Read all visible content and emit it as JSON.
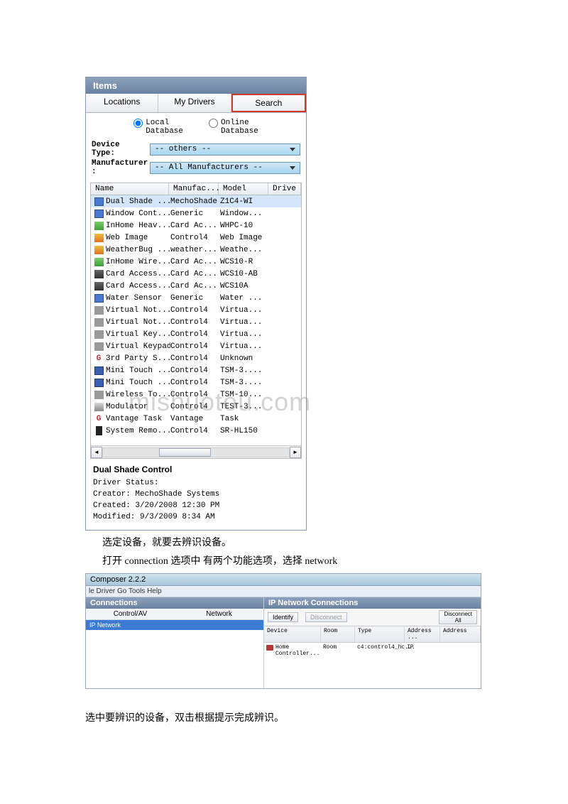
{
  "items_panel": {
    "title": "Items",
    "tabs": [
      "Locations",
      "My Drivers",
      "Search"
    ],
    "radios": {
      "local": "Local\nDatabase",
      "online": "Online\nDatabase"
    },
    "filters": {
      "device_type_label": "Device\nType:",
      "device_type_value": "-- others --",
      "manufacturer_label": "Manufacturer\n:",
      "manufacturer_value": "-- All Manufacturers --"
    },
    "columns": {
      "name": "Name",
      "manufacturer": "Manufac...",
      "model": "Model",
      "driver": "Drive"
    },
    "rows": [
      {
        "icon": "ico-blue",
        "name": "Dual Shade ...",
        "manufacturer": "MechoShade",
        "model": "Z1C4-WI",
        "selected": true
      },
      {
        "icon": "ico-blue",
        "name": "Window Cont...",
        "manufacturer": "Generic",
        "model": "Window..."
      },
      {
        "icon": "ico-grn",
        "name": "InHome Heav...",
        "manufacturer": "Card Ac...",
        "model": "WHPC-10"
      },
      {
        "icon": "ico-wb",
        "name": "Web Image",
        "manufacturer": "Control4",
        "model": "Web Image"
      },
      {
        "icon": "ico-wb",
        "name": "WeatherBug ...",
        "manufacturer": "weather...",
        "model": "Weathe..."
      },
      {
        "icon": "ico-grn",
        "name": "InHome Wire...",
        "manufacturer": "Card Ac...",
        "model": "WCS10-R"
      },
      {
        "icon": "ico-dk",
        "name": "Card Access...",
        "manufacturer": "Card Ac...",
        "model": "WCS10-AB"
      },
      {
        "icon": "ico-dk",
        "name": "Card Access...",
        "manufacturer": "Card Ac...",
        "model": "WCS10A"
      },
      {
        "icon": "ico-blue",
        "name": "Water Sensor",
        "manufacturer": "Generic",
        "model": "Water ..."
      },
      {
        "icon": "ico-gr",
        "name": "Virtual Not...",
        "manufacturer": "Control4",
        "model": "Virtua..."
      },
      {
        "icon": "ico-gr",
        "name": "Virtual Not...",
        "manufacturer": "Control4",
        "model": "Virtua..."
      },
      {
        "icon": "ico-gr",
        "name": "Virtual Key...",
        "manufacturer": "Control4",
        "model": "Virtua..."
      },
      {
        "icon": "ico-gr",
        "name": "Virtual Keypad",
        "manufacturer": "Control4",
        "model": "Virtua..."
      },
      {
        "icon": "g4",
        "name": "3rd Party S...",
        "manufacturer": "Control4",
        "model": "Unknown"
      },
      {
        "icon": "ico-mt",
        "name": "Mini Touch ...",
        "manufacturer": "Control4",
        "model": "TSM-3...."
      },
      {
        "icon": "ico-mt",
        "name": "Mini Touch ...",
        "manufacturer": "Control4",
        "model": "TSM-3...."
      },
      {
        "icon": "ico-gr",
        "name": "Wireless To...",
        "manufacturer": "Control4",
        "model": "TSM-10..."
      },
      {
        "icon": "ico-mod",
        "name": "Modulator",
        "manufacturer": "Control4",
        "model": "TEST-3..."
      },
      {
        "icon": "g4",
        "name": "Vantage Task",
        "manufacturer": "Vantage",
        "model": "Task"
      },
      {
        "icon": "ico-rm",
        "name": "System Remo...",
        "manufacturer": "Control4",
        "model": "SR-HL150"
      }
    ],
    "details": {
      "title": "Dual Shade Control",
      "lines": [
        "Driver Status:",
        "Creator: MechoShade Systems",
        "Created: 3/20/2008 12:30 PM",
        "Modified: 9/3/2009 8:34 AM"
      ]
    }
  },
  "body_text": {
    "line1": "选定设备，就要去辨识设备。",
    "line2": "打开 connection  选项中  有两个功能选项，选择 network",
    "line3": "选中要辨识的设备，双击根据提示完成辨识。"
  },
  "composer": {
    "title": "Composer 2.2.2",
    "menu": "le   Driver   Go   Tools   Help",
    "left": {
      "header": "Connections",
      "tabs": [
        "Control/AV",
        "Network"
      ],
      "item": "IP Network"
    },
    "right": {
      "header": "IP Network Connections",
      "btns": {
        "identify": "Identify",
        "disconnect": "Disconnect",
        "disc_all": "Disconnect\nAll"
      },
      "cols": [
        "Device",
        "Room",
        "Type",
        "Address ...",
        "Address"
      ],
      "row": {
        "device": "Home Controller...",
        "room": "Room",
        "type": "c4:control4_hc...",
        "addr": "IP"
      }
    }
  },
  "watermark": "mishuotou.com"
}
